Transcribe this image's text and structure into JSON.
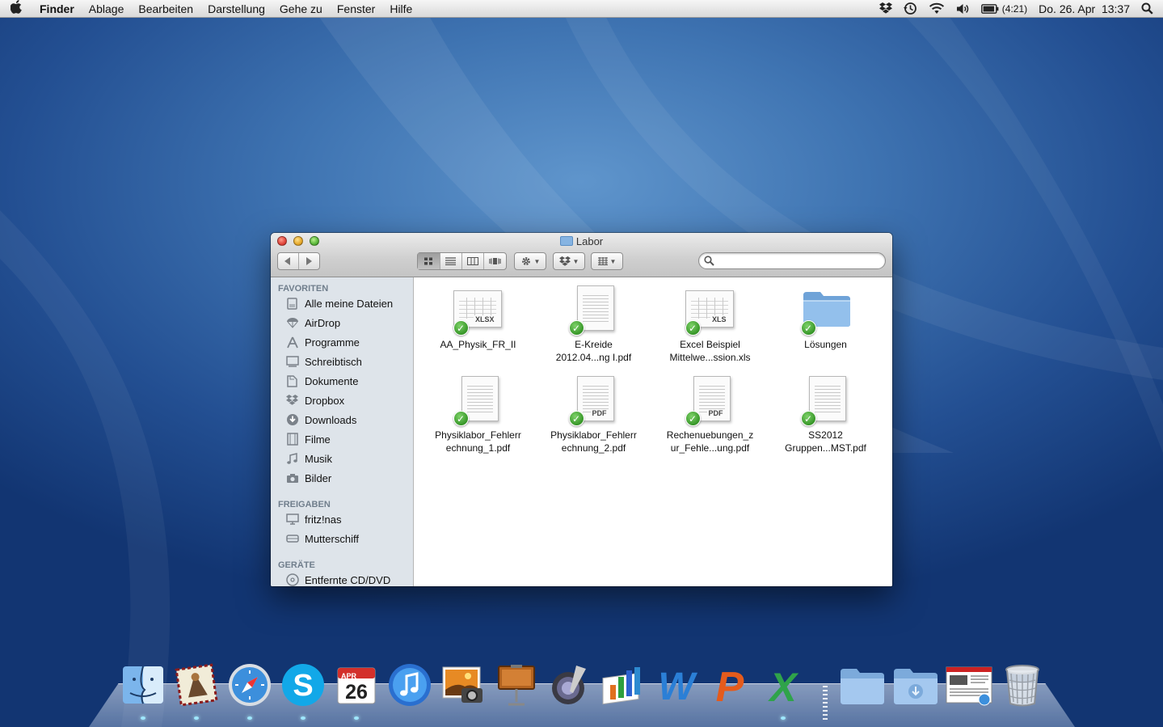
{
  "menubar": {
    "apple_icon": "apple-icon",
    "app_name": "Finder",
    "menus": [
      "Ablage",
      "Bearbeiten",
      "Darstellung",
      "Gehe zu",
      "Fenster",
      "Hilfe"
    ],
    "battery_time": "(4:21)",
    "clock": "Do. 26. Apr  13:37"
  },
  "window": {
    "title": "Labor",
    "sidebar": {
      "favorites_header": "FAVORITEN",
      "favorites": [
        {
          "label": "Alle meine Dateien",
          "icon": "all-files-icon"
        },
        {
          "label": "AirDrop",
          "icon": "airdrop-icon"
        },
        {
          "label": "Programme",
          "icon": "applications-icon"
        },
        {
          "label": "Schreibtisch",
          "icon": "desktop-icon"
        },
        {
          "label": "Dokumente",
          "icon": "documents-icon"
        },
        {
          "label": "Dropbox",
          "icon": "dropbox-icon"
        },
        {
          "label": "Downloads",
          "icon": "downloads-icon"
        },
        {
          "label": "Filme",
          "icon": "movies-icon"
        },
        {
          "label": "Musik",
          "icon": "music-icon"
        },
        {
          "label": "Bilder",
          "icon": "pictures-icon"
        }
      ],
      "shared_header": "FREIGABEN",
      "shared": [
        {
          "label": "fritz!nas",
          "icon": "network-drive-icon"
        },
        {
          "label": "Mutterschiff",
          "icon": "network-computer-icon"
        }
      ],
      "devices_header": "GERÄTE",
      "devices": [
        {
          "label": "Entfernte CD/DVD",
          "icon": "optical-disc-icon"
        }
      ]
    },
    "files": [
      {
        "line1": "AA_Physik_FR_II",
        "line2": "",
        "type": "XLSX",
        "kind": "spreadsheet"
      },
      {
        "line1": "E-Kreide",
        "line2": "2012.04...ng I.pdf",
        "type": "",
        "kind": "document"
      },
      {
        "line1": "Excel Beispiel",
        "line2": "Mittelwe...ssion.xls",
        "type": "XLS",
        "kind": "spreadsheet"
      },
      {
        "line1": "Lösungen",
        "line2": "",
        "type": "",
        "kind": "folder"
      },
      {
        "line1": "Physiklabor_Fehlerr",
        "line2": "echnung_1.pdf",
        "type": "",
        "kind": "document"
      },
      {
        "line1": "Physiklabor_Fehlerr",
        "line2": "echnung_2.pdf",
        "type": "PDF",
        "kind": "document"
      },
      {
        "line1": "Rechenuebungen_z",
        "line2": "ur_Fehle...ung.pdf",
        "type": "PDF",
        "kind": "document"
      },
      {
        "line1": "SS2012",
        "line2": "Gruppen...MST.pdf",
        "type": "",
        "kind": "document"
      }
    ]
  },
  "dock": {
    "apps": [
      "finder-icon",
      "mail-icon",
      "safari-icon",
      "skype-icon",
      "calendar-icon",
      "itunes-icon",
      "iphoto-icon",
      "keynote-icon",
      "aperture-icon",
      "numbers-icon",
      "word-icon",
      "powerpoint-icon",
      "excel-icon"
    ],
    "calendar_month": "APR",
    "calendar_day": "26",
    "stacks": [
      "documents-stack-icon",
      "downloads-stack-icon",
      "web-screenshot-icon",
      "trash-icon"
    ]
  }
}
